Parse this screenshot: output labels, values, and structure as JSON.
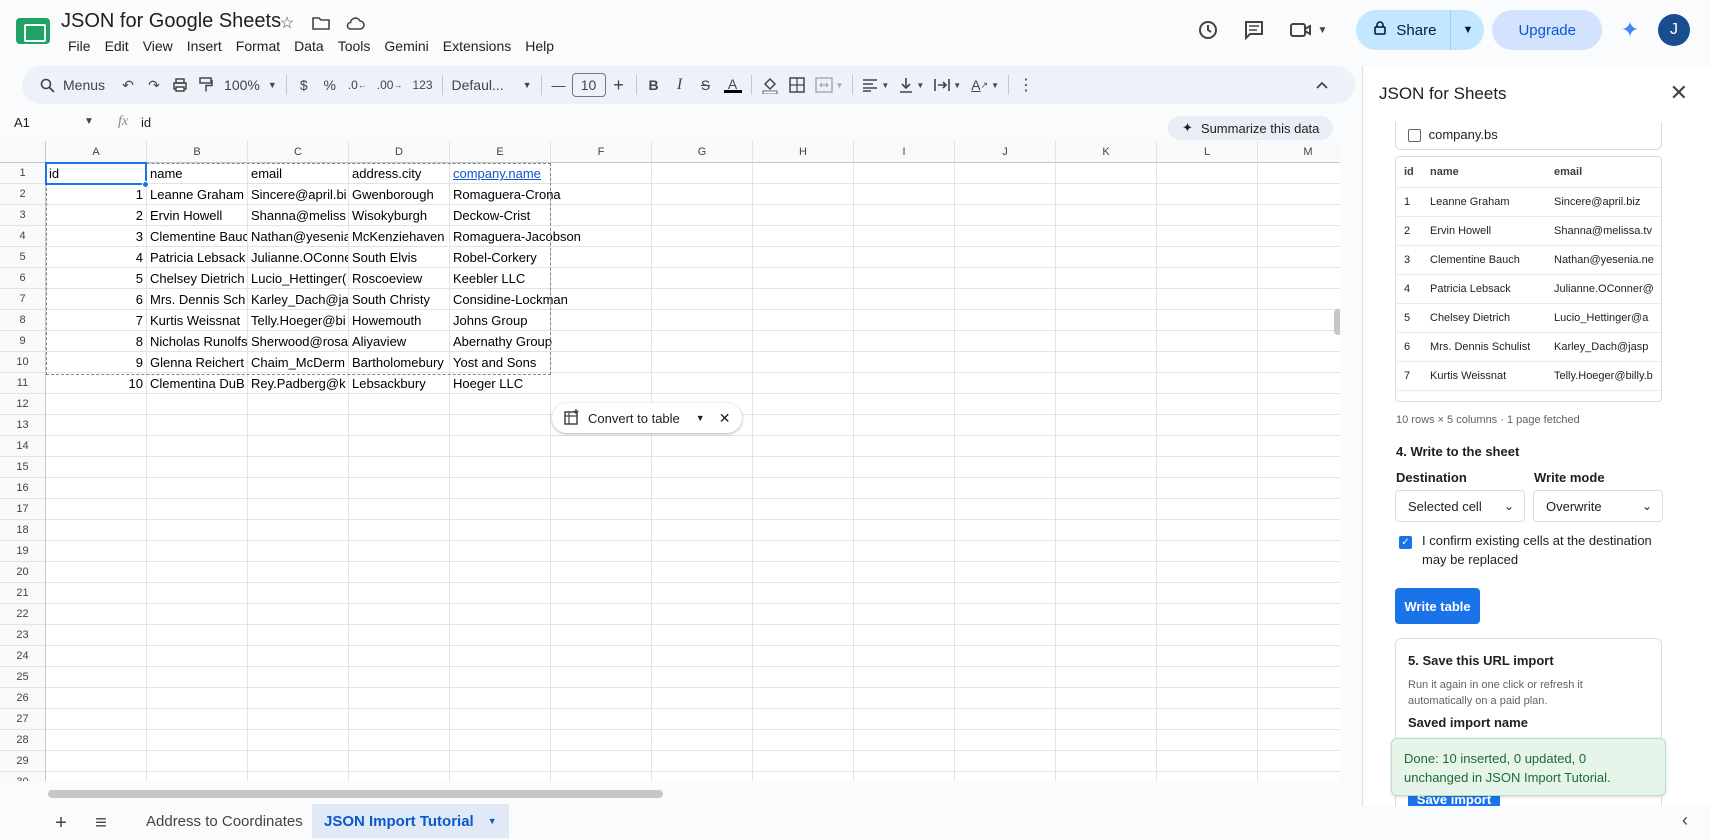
{
  "header": {
    "doc_title": "JSON for Google Sheets",
    "menu": [
      "File",
      "Edit",
      "View",
      "Insert",
      "Format",
      "Data",
      "Tools",
      "Gemini",
      "Extensions",
      "Help"
    ],
    "share_label": "Share",
    "upgrade_label": "Upgrade",
    "avatar_initial": "J"
  },
  "toolbar": {
    "menus_label": "Menus",
    "zoom": "100%",
    "currency": "$",
    "percent": "%",
    "dec_decrease": ".0",
    "dec_increase": ".00",
    "number_format": "123",
    "font": "Defaul...",
    "font_size": "10"
  },
  "formula_bar": {
    "cell_ref": "A1",
    "fx": "fx",
    "value": "id",
    "summarize_label": "Summarize this data"
  },
  "grid": {
    "columns": [
      "A",
      "B",
      "C",
      "D",
      "E",
      "F",
      "G",
      "H",
      "I",
      "J",
      "K",
      "L",
      "M"
    ],
    "row_count": 30,
    "header_row": [
      "id",
      "name",
      "email",
      "address.city",
      "company.name"
    ],
    "rows": [
      [
        "1",
        "Leanne Graham",
        "Sincere@april.bi",
        "Gwenborough",
        "Romaguera-Crona"
      ],
      [
        "2",
        "Ervin Howell",
        "Shanna@meliss",
        "Wisokyburgh",
        "Deckow-Crist"
      ],
      [
        "3",
        "Clementine Bauc",
        "Nathan@yesenia",
        "McKenziehaven",
        "Romaguera-Jacobson"
      ],
      [
        "4",
        "Patricia Lebsack",
        "Julianne.OConne",
        "South Elvis",
        "Robel-Corkery"
      ],
      [
        "5",
        "Chelsey Dietrich",
        "Lucio_Hettinger(",
        "Roscoeview",
        "Keebler LLC"
      ],
      [
        "6",
        "Mrs. Dennis Sch",
        "Karley_Dach@ja",
        "South Christy",
        "Considine-Lockman"
      ],
      [
        "7",
        "Kurtis Weissnat",
        "Telly.Hoeger@bi",
        "Howemouth",
        "Johns Group"
      ],
      [
        "8",
        "Nicholas Runolfs",
        "Sherwood@rosa",
        "Aliyaview",
        "Abernathy Group"
      ],
      [
        "9",
        "Glenna Reichert",
        "Chaim_McDerm",
        "Bartholomebury",
        "Yost and Sons"
      ],
      [
        "10",
        "Clementina DuB",
        "Rey.Padberg@k",
        "Lebsackbury",
        "Hoeger LLC"
      ]
    ],
    "convert_label": "Convert to table"
  },
  "sheets": {
    "tabs": [
      {
        "label": "Address to Coordinates",
        "active": false
      },
      {
        "label": "JSON Import Tutorial",
        "active": true
      }
    ]
  },
  "panel": {
    "title": "JSON for Sheets",
    "field_checkbox": "company.bs",
    "preview_headers": [
      "id",
      "name",
      "email"
    ],
    "preview_rows": [
      [
        "1",
        "Leanne Graham",
        "Sincere@april.biz"
      ],
      [
        "2",
        "Ervin Howell",
        "Shanna@melissa.tv"
      ],
      [
        "3",
        "Clementine Bauch",
        "Nathan@yesenia.ne"
      ],
      [
        "4",
        "Patricia Lebsack",
        "Julianne.OConner@"
      ],
      [
        "5",
        "Chelsey Dietrich",
        "Lucio_Hettinger@a"
      ],
      [
        "6",
        "Mrs. Dennis Schulist",
        "Karley_Dach@jasp"
      ],
      [
        "7",
        "Kurtis Weissnat",
        "Telly.Hoeger@billy.b"
      ]
    ],
    "preview_summary": "10 rows × 5 columns · 1 page fetched",
    "write_heading": "4. Write to the sheet",
    "destination_label": "Destination",
    "destination_value": "Selected cell",
    "write_mode_label": "Write mode",
    "write_mode_value": "Overwrite",
    "confirm_text": "I confirm existing cells at the destination may be replaced",
    "write_button": "Write table",
    "save_heading": "5. Save this URL import",
    "save_desc": "Run it again in one click or refresh it automatically on a paid plan.",
    "saved_name_label": "Saved import name",
    "save_button": "Save import",
    "toast": "Done: 10 inserted, 0 updated, 0 unchanged in JSON Import Tutorial."
  }
}
